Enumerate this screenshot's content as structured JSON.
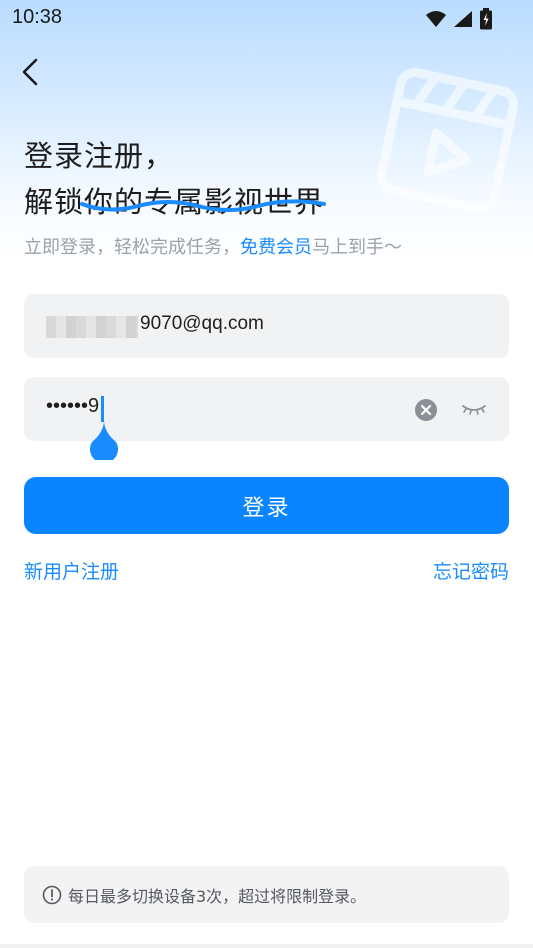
{
  "status_bar": {
    "time": "10:38"
  },
  "headline": {
    "line1": "登录注册，",
    "line2": "解锁你的专属影视世界"
  },
  "subtitle": {
    "prefix": "立即登录，轻松完成任务，",
    "highlight": "免费会员",
    "suffix": "马上到手～"
  },
  "email_field": {
    "value_visible": "9070@qq.com"
  },
  "password_field": {
    "value": "••••••9"
  },
  "login_button": {
    "label": "登录"
  },
  "links": {
    "register": "新用户注册",
    "forgot_password": "忘记密码"
  },
  "notice": {
    "text": "每日最多切换设备3次，超过将限制登录。"
  },
  "colors": {
    "accent": "#0a84ff",
    "link": "#1a8cff",
    "subtitle": "#9aa1a8",
    "field_bg": "#f1f2f4"
  },
  "icons": [
    "wifi-icon",
    "signal-icon",
    "battery-icon",
    "back-arrow-icon",
    "video-deco-icon",
    "clear-icon",
    "eye-closed-icon",
    "info-icon"
  ]
}
